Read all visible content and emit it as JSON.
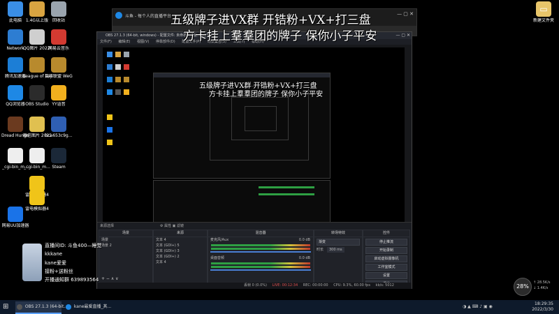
{
  "desktop_icons": [
    {
      "label": "此电脑",
      "icon": "computer-icon",
      "color": "#3a8ee6"
    },
    {
      "label": "1.4G以上版",
      "icon": "folder-icon",
      "color": "#d9a441"
    },
    {
      "label": "回收站",
      "icon": "recycle-bin-icon",
      "color": "#9aa4ae"
    },
    {
      "label": "Network",
      "icon": "network-icon",
      "color": "#2d7dd2"
    },
    {
      "label": "QQ图片 20220312...",
      "icon": "image-file-icon",
      "color": "#cfcfcf"
    },
    {
      "label": "网易云音乐",
      "icon": "netease-music-icon",
      "color": "#d33a31"
    },
    {
      "label": "腾讯加速器",
      "icon": "accelerator-icon",
      "color": "#1c7ed6"
    },
    {
      "label": "League of Legends",
      "icon": "lol-icon",
      "color": "#b88a2d"
    },
    {
      "label": "英雄联盟 WeGame版",
      "icon": "wegame-icon",
      "color": "#b88a2d"
    },
    {
      "label": "QQ浏览器",
      "icon": "qq-browser-icon",
      "color": "#1e88e5"
    },
    {
      "label": "OBS Studio",
      "icon": "obs-icon",
      "color": "#2b2b2b"
    },
    {
      "label": "YY语音",
      "icon": "yy-icon",
      "color": "#f2b01e"
    },
    {
      "label": "Dread Hunger",
      "icon": "game-icon",
      "color": "#6b3a1f"
    },
    {
      "label": "微信图片 2022031...",
      "icon": "image-file-icon",
      "color": "#e0c050"
    },
    {
      "label": "bca653c9g...",
      "icon": "shortcut-icon",
      "color": "#2f5fb3"
    },
    {
      "label": "_cgi-bin_m...",
      "icon": "document-icon",
      "color": "#eeeeee"
    },
    {
      "label": "_cgi-bin_m...",
      "icon": "document-icon",
      "color": "#eeeeee"
    },
    {
      "label": "Steam",
      "icon": "steam-icon",
      "color": "#1b2838"
    },
    {
      "label": "雷电多开器4",
      "icon": "emulator-icon",
      "color": "#f0c419"
    },
    {
      "label": "网易UU加速器",
      "icon": "uu-icon",
      "color": "#1a73e8"
    },
    {
      "label": "雷电模拟器4",
      "icon": "emulator-icon",
      "color": "#f0c419"
    },
    {
      "label": "新建文件夹",
      "icon": "new-folder-icon",
      "color": "#e8c56a"
    }
  ],
  "browser": {
    "tab_title": "斗鱼 - 每个人的直播平台",
    "overlay_line1": "五级牌子进VX群  开锆粉+VX+打三盘",
    "overlay_line2": "方卡挂上羣羣团的牌子 保你小子平安"
  },
  "obs": {
    "title": "OBS 27.1.3 (64-bit, windows) - 配置文件: 未命名 - 场景: 未命名",
    "menu": [
      "文件(F)",
      "编辑(E)",
      "视图(V)",
      "停靠部件(D)",
      "配置文件(P)",
      "场景集合(S)",
      "工具(T)",
      "帮助(H)"
    ],
    "docks": {
      "scenes_title": "场景",
      "scenes": [
        "场景",
        "场景 2"
      ],
      "sources_title": "来源",
      "sources": [
        "文本 4",
        "文本 (GDI+) 5",
        "文本 (GDI+) 3",
        "文本 (GDI+) 2",
        "文本 4"
      ],
      "mixer_title": "混音器",
      "mixer": [
        {
          "name": "麦克风/Aux",
          "level": "0.0 dB"
        },
        {
          "name": "桌面音频",
          "level": "0.0 dB"
        }
      ],
      "transitions_title": "转场特效",
      "transition_type": "渐变",
      "duration_label": "时长",
      "duration_value": "300 ms",
      "controls_title": "控件",
      "controls": [
        "停止推流",
        "开始录制",
        "启动虚拟摄像机",
        "工作室模式",
        "设置",
        "退出"
      ]
    },
    "status": {
      "dropped": "丢帧 0 (0.0%)",
      "live": "LIVE: 00:12:34",
      "rec": "REC: 00:00:00",
      "cpu": "CPU: 9.3%, 60.00 fps",
      "kbps": "kb/s: 5012"
    },
    "preview_label": "来源选择"
  },
  "streamer": {
    "line1": "直播间ID: 斗鱼400—睡觉",
    "line2": "kkkane",
    "line3": "kane爱爱",
    "line4": "接粉+送粉丝",
    "line5": "开播通知群 639893564"
  },
  "perf": {
    "percent": "28",
    "up": "↑ 28.5K/s",
    "down": "↓ 1.4K/s"
  },
  "taskbar": {
    "items": [
      {
        "label": "OBS 27.1.3 (64-bit...",
        "icon": "obs-icon"
      },
      {
        "label": "kane最爱直播_其...",
        "icon": "qq-browser-icon"
      }
    ],
    "time": "18:29:35",
    "date": "2022/3/30"
  }
}
